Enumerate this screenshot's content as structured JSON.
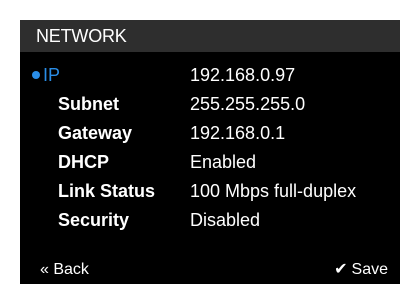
{
  "screen": {
    "title": "NETWORK"
  },
  "colors": {
    "accent": "#2a8de6",
    "background": "#000000",
    "header_background": "#2e2e2e",
    "text": "#ffffff"
  },
  "settings": [
    {
      "label": "IP",
      "value": "192.168.0.97",
      "selected": true
    },
    {
      "label": "Subnet",
      "value": "255.255.255.0",
      "selected": false
    },
    {
      "label": "Gateway",
      "value": "192.168.0.1",
      "selected": false
    },
    {
      "label": "DHCP",
      "value": "Enabled",
      "selected": false
    },
    {
      "label": "Link Status",
      "value": "100 Mbps full-duplex",
      "selected": false
    },
    {
      "label": "Security",
      "value": "Disabled",
      "selected": false
    }
  ],
  "footer": {
    "back_label": "« Back",
    "save_icon": "check-icon",
    "save_label": "Save"
  }
}
